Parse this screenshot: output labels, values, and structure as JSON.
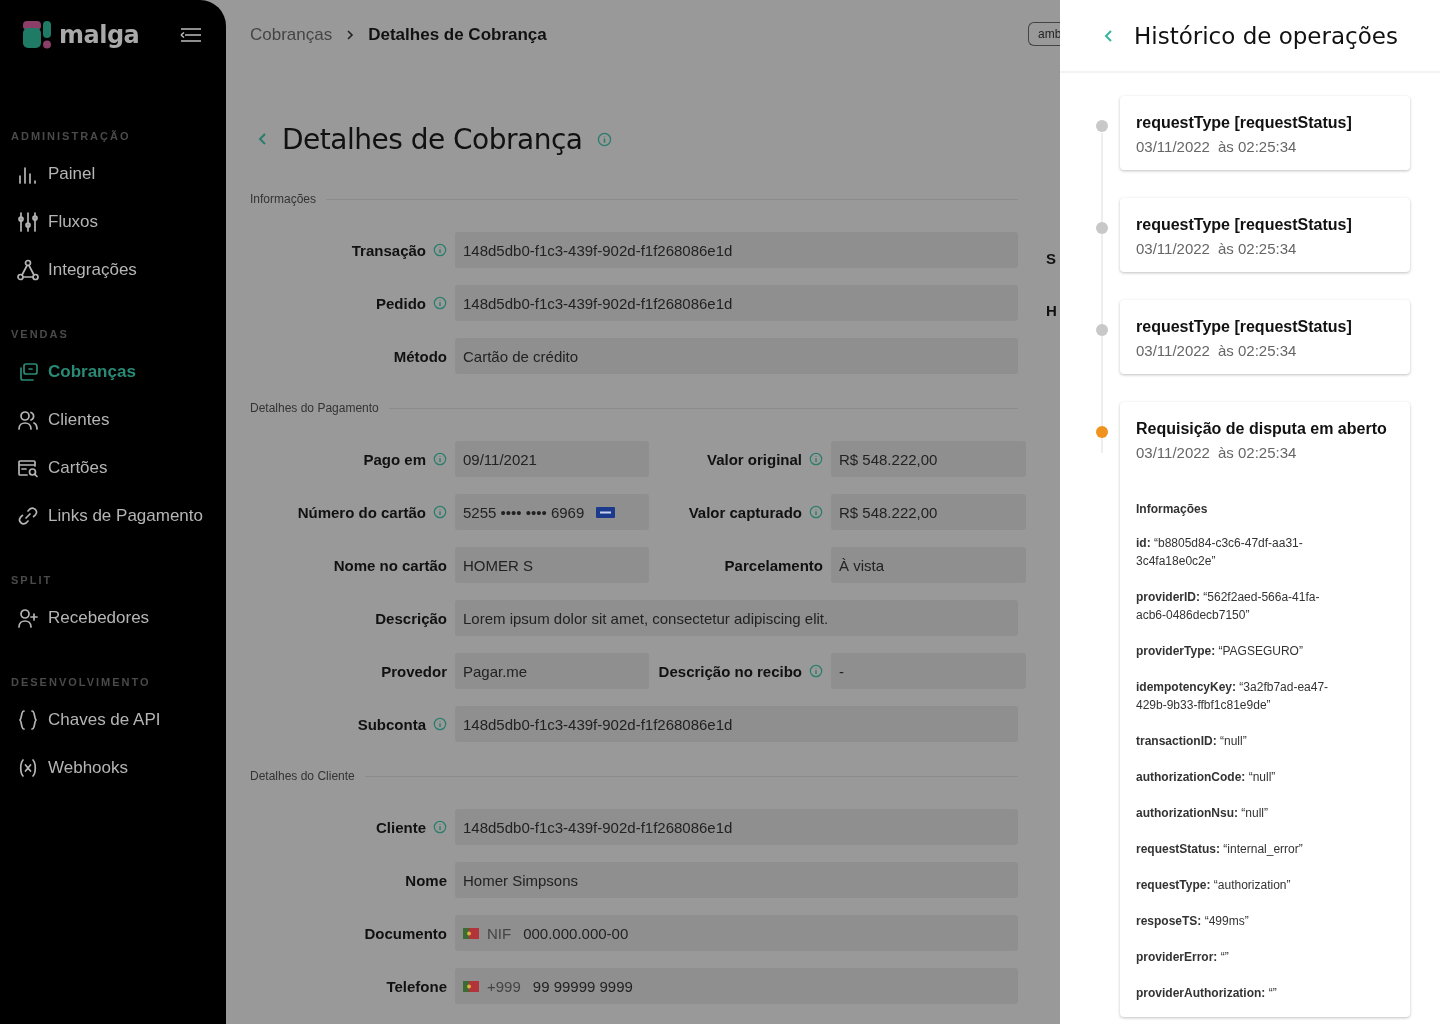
{
  "sidebar": {
    "logo": "malga",
    "sections": [
      {
        "title": "ADMINISTRAÇÃO",
        "items": [
          {
            "label": "Painel",
            "selected": false
          },
          {
            "label": "Fluxos",
            "selected": false
          },
          {
            "label": "Integrações",
            "selected": false
          }
        ]
      },
      {
        "title": "VENDAS",
        "items": [
          {
            "label": "Cobranças",
            "selected": true
          },
          {
            "label": "Clientes",
            "selected": false
          },
          {
            "label": "Cartões",
            "selected": false
          },
          {
            "label": "Links de Pagamento",
            "selected": false
          }
        ]
      },
      {
        "title": "SPLIT",
        "items": [
          {
            "label": "Recebedores",
            "selected": false
          }
        ]
      },
      {
        "title": "DESENVOLVIMENTO",
        "items": [
          {
            "label": "Chaves de API",
            "selected": false
          },
          {
            "label": "Webhooks",
            "selected": false
          }
        ]
      }
    ]
  },
  "breadcrumb": [
    {
      "label": "Cobranças",
      "current": false
    },
    {
      "label": "Detalhes de Cobrança",
      "current": true
    }
  ],
  "environment_button": "amb",
  "page_title": "Detalhes de Cobrança",
  "sections": [
    {
      "title": "Informações",
      "rows": [
        {
          "kind": "single",
          "fields": [
            {
              "label": "Transação",
              "info": true,
              "value": "148d5db0-f1c3-439f-902d-f1f268086e1d"
            }
          ]
        },
        {
          "kind": "single",
          "fields": [
            {
              "label": "Pedido",
              "info": true,
              "value": "148d5db0-f1c3-439f-902d-f1f268086e1d"
            }
          ]
        },
        {
          "kind": "single",
          "fields": [
            {
              "label": "Método",
              "info": false,
              "value": "Cartão de crédito"
            }
          ]
        }
      ]
    },
    {
      "title": "Detalhes do Pagamento",
      "rows": [
        {
          "kind": "double",
          "fields": [
            {
              "label": "Pago em",
              "info": true,
              "value": "09/11/2021"
            },
            {
              "label": "Valor original",
              "info": true,
              "value": "R$ 548.222,00"
            }
          ]
        },
        {
          "kind": "double",
          "fields": [
            {
              "label": "Número do cartão",
              "info": true,
              "value": "5255 •••• •••• 6969",
              "card_brand": true
            },
            {
              "label": "Valor capturado",
              "info": true,
              "value": "R$ 548.222,00"
            }
          ]
        },
        {
          "kind": "double",
          "fields": [
            {
              "label": "Nome no cartão",
              "info": false,
              "value": "HOMER S"
            },
            {
              "label": "Parcelamento",
              "info": false,
              "value": "À vista"
            }
          ]
        },
        {
          "kind": "single",
          "fields": [
            {
              "label": "Descrição",
              "info": false,
              "value": "Lorem ipsum dolor sit amet, consectetur adipiscing elit."
            }
          ]
        },
        {
          "kind": "double",
          "fields": [
            {
              "label": "Provedor",
              "info": false,
              "value": "Pagar.me"
            },
            {
              "label": "Descrição no recibo",
              "info": true,
              "value": "-"
            }
          ]
        },
        {
          "kind": "single",
          "fields": [
            {
              "label": "Subconta",
              "info": true,
              "value": "148d5db0-f1c3-439f-902d-f1f268086e1d"
            }
          ]
        }
      ]
    },
    {
      "title": "Detalhes do Cliente",
      "rows": [
        {
          "kind": "single",
          "fields": [
            {
              "label": "Cliente",
              "info": true,
              "value": "148d5db0-f1c3-439f-902d-f1f268086e1d"
            }
          ]
        },
        {
          "kind": "single",
          "fields": [
            {
              "label": "Nome",
              "info": false,
              "value": "Homer Simpsons"
            }
          ]
        },
        {
          "kind": "single",
          "fields": [
            {
              "label": "Documento",
              "info": false,
              "flag": true,
              "prefix": "NIF",
              "value": "000.000.000-00"
            }
          ]
        },
        {
          "kind": "single",
          "fields": [
            {
              "label": "Telefone",
              "info": false,
              "flag": true,
              "prefix": "+999",
              "value": "99 99999 9999"
            }
          ]
        }
      ]
    }
  ],
  "side_column_labels": [
    "S",
    "H"
  ],
  "history": {
    "title": "Histórico de operações",
    "events": [
      {
        "title": "requestType [requestStatus]",
        "date": "03/11/2022",
        "time": "às 02:25:34",
        "color": "#c8c8c8"
      },
      {
        "title": "requestType [requestStatus]",
        "date": "03/11/2022",
        "time": "às 02:25:34",
        "color": "#c8c8c8"
      },
      {
        "title": "requestType [requestStatus]",
        "date": "03/11/2022",
        "time": "às 02:25:34",
        "color": "#c8c8c8"
      },
      {
        "title": "Requisição de disputa em aberto",
        "date": "03/11/2022",
        "time": "às 02:25:34",
        "color": "#f0921e",
        "details": {
          "heading": "Informações",
          "entries": [
            "**id:** “b8805d84-c3c6-47df-aa31-3c4fa18e0c2e”",
            "**providerID:** “562f2aed-566a-41fa-acb6-0486decb7150”",
            "**providerType:** “PAGSEGURO”",
            "**idempotencyKey:** “3a2fb7ad-ea47-429b-9b33-ffbf1c81e9de”",
            "**transactionID:** “null”",
            "**authorizationCode:** “null”",
            "**authorizationNsu:** “null”",
            "**requestStatus:** “internal_error”",
            "**requestType:** “authorization”",
            "**resposeTS:** “499ms”",
            "**providerError:** “”",
            "**providerAuthorization:** “”"
          ]
        }
      }
    ]
  }
}
